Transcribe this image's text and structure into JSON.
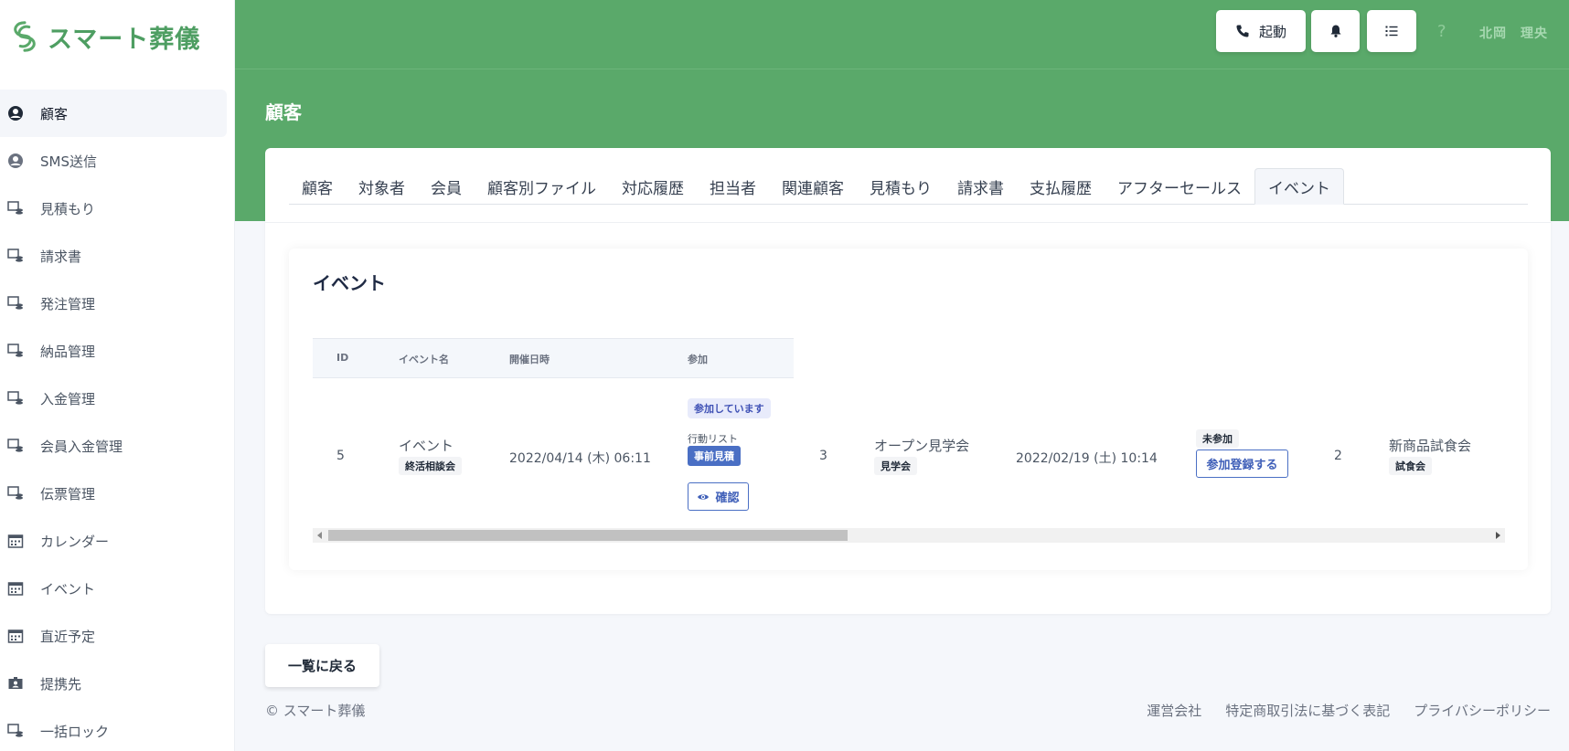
{
  "app": {
    "logo_text": "スマート葬儀",
    "brand_color": "#5aa96a"
  },
  "sidebar": {
    "items": [
      {
        "label": "顧客",
        "icon": "user-circle-icon",
        "active": true
      },
      {
        "label": "SMS送信",
        "icon": "user-circle-icon"
      },
      {
        "label": "見積もり",
        "icon": "document-stack-icon"
      },
      {
        "label": "請求書",
        "icon": "document-stack-icon"
      },
      {
        "label": "発注管理",
        "icon": "document-stack-icon"
      },
      {
        "label": "納品管理",
        "icon": "document-stack-icon"
      },
      {
        "label": "入金管理",
        "icon": "document-stack-icon"
      },
      {
        "label": "会員入金管理",
        "icon": "document-stack-icon"
      },
      {
        "label": "伝票管理",
        "icon": "document-stack-icon"
      },
      {
        "label": "カレンダー",
        "icon": "calendar-icon"
      },
      {
        "label": "イベント",
        "icon": "calendar-icon"
      },
      {
        "label": "直近予定",
        "icon": "calendar-icon"
      },
      {
        "label": "提携先",
        "icon": "id-card-icon"
      },
      {
        "label": "一括ロック",
        "icon": "document-stack-icon"
      }
    ]
  },
  "header": {
    "start_label": "起動",
    "help": "?",
    "user_name": "北岡　理央",
    "page_title": "顧客"
  },
  "tabs": [
    {
      "label": "顧客"
    },
    {
      "label": "対象者"
    },
    {
      "label": "会員"
    },
    {
      "label": "顧客別ファイル"
    },
    {
      "label": "対応履歴"
    },
    {
      "label": "担当者"
    },
    {
      "label": "関連顧客"
    },
    {
      "label": "見積もり"
    },
    {
      "label": "請求書"
    },
    {
      "label": "支払履歴"
    },
    {
      "label": "アフターセールス"
    },
    {
      "label": "イベント",
      "active": true
    }
  ],
  "events": {
    "title": "イベント",
    "columns": [
      "ID",
      "イベント名",
      "開催日時",
      "参加"
    ],
    "rows": [
      {
        "id": "5",
        "name": "イベント",
        "tag": "終活相談会",
        "datetime": "2022/04/14 (木) 06:11",
        "status": "参加しています",
        "action_list_label": "行動リスト",
        "action_badge": "事前見積",
        "confirm_label": "確認"
      },
      {
        "id": "3",
        "name": "オープン見学会",
        "tag": "見学会",
        "datetime": "2022/02/19 (土) 10:14",
        "status": "未参加",
        "register_label": "参加登録する"
      },
      {
        "id": "2",
        "name": "新商品試食会",
        "tag": "試食会"
      }
    ]
  },
  "back_button": "一覧に戻る",
  "footer": {
    "copyright": "© スマート葬儀",
    "links": [
      "運営会社",
      "特定商取引法に基づく表記",
      "プライバシーポリシー"
    ]
  }
}
